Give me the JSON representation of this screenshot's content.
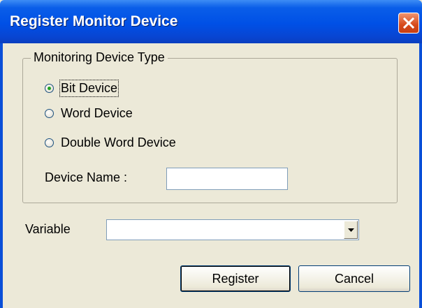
{
  "window": {
    "title": "Register Monitor Device"
  },
  "group": {
    "legend": "Monitoring Device Type",
    "options": [
      {
        "label": "Bit Device",
        "checked": true
      },
      {
        "label": "Word Device",
        "checked": false
      },
      {
        "label": "Double Word Device",
        "checked": false
      }
    ],
    "device_name_label": "Device Name :",
    "device_name_value": ""
  },
  "variable": {
    "label": "Variable",
    "value": ""
  },
  "buttons": {
    "register": "Register",
    "cancel": "Cancel"
  },
  "colors": {
    "titlebar": "#0050e6",
    "close": "#d64a1c",
    "face": "#ece9d8"
  },
  "icons": {
    "close": "close-x-icon",
    "dropdown": "chevron-down-icon"
  }
}
